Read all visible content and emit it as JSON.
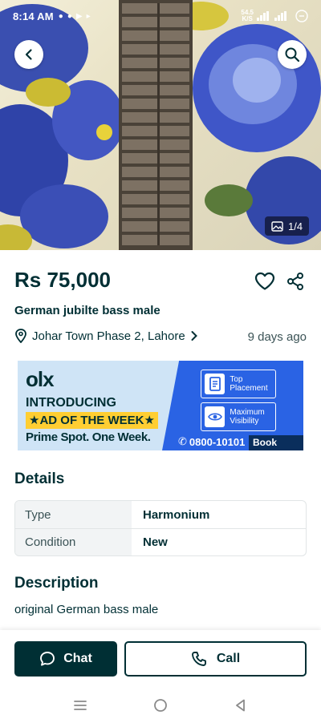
{
  "status_bar": {
    "time": "8:14 AM",
    "net_speed_value": "54.5",
    "net_speed_unit": "K/S"
  },
  "gallery": {
    "counter": "1/4"
  },
  "listing": {
    "price": "Rs 75,000",
    "title": "German jubilte bass male",
    "location": "Johar Town Phase 2, Lahore",
    "posted": "9 days ago"
  },
  "banner": {
    "logo": "olx",
    "line1": "INTRODUCING",
    "line2": "★AD OF THE WEEK★",
    "line3": "Prime Spot. One Week.",
    "feature1": "Top Placement",
    "feature2": "Maximum Visibility",
    "phone": "0800-10101",
    "cta": "Book Now"
  },
  "details": {
    "heading": "Details",
    "rows": [
      {
        "key": "Type",
        "value": "Harmonium"
      },
      {
        "key": "Condition",
        "value": "New"
      }
    ]
  },
  "description": {
    "heading": "Description",
    "text": "original German bass male"
  },
  "actions": {
    "chat_label": "Chat",
    "call_label": "Call"
  },
  "colors": {
    "primary": "#002f34",
    "banner_blue": "#2a63e4",
    "banner_yellow": "#ffce32"
  }
}
